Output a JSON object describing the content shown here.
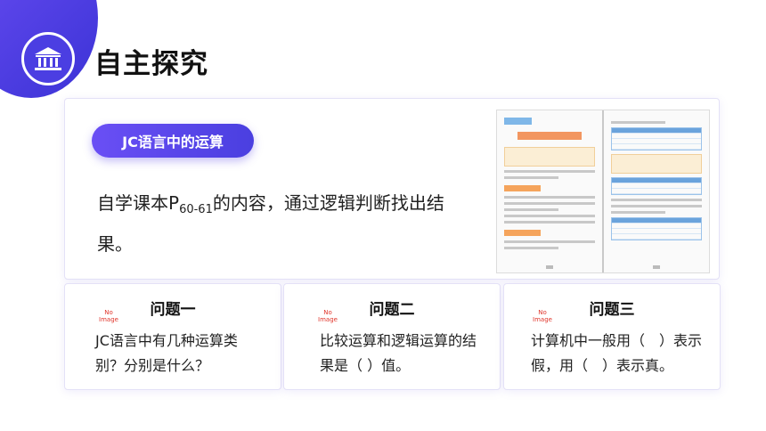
{
  "header": {
    "title": "自主探究",
    "emblem_icon": "museum-icon",
    "accent_color": "#4b3ee2"
  },
  "intro": {
    "pill_label": "JC语言中的运算",
    "text_before_sub": "自学课本P",
    "text_sub": "60-61",
    "text_after_sub": "的内容，通过逻辑判断找出结果。"
  },
  "textbook_preview": {
    "icon": "textbook-pages-image"
  },
  "questions": [
    {
      "title": "问题一",
      "no_image_top": "No",
      "no_image_bottom": "Image",
      "text": "JC语言中有几种运算类别？分别是什么？"
    },
    {
      "title": "问题二",
      "no_image_top": "No",
      "no_image_bottom": "Image",
      "text": "比较运算和逻辑运算的结果是（ ）值。"
    },
    {
      "title": "问题三",
      "no_image_top": "No",
      "no_image_bottom": "Image",
      "text": "计算机中一般用（　）表示假，用（　）表示真。"
    }
  ]
}
